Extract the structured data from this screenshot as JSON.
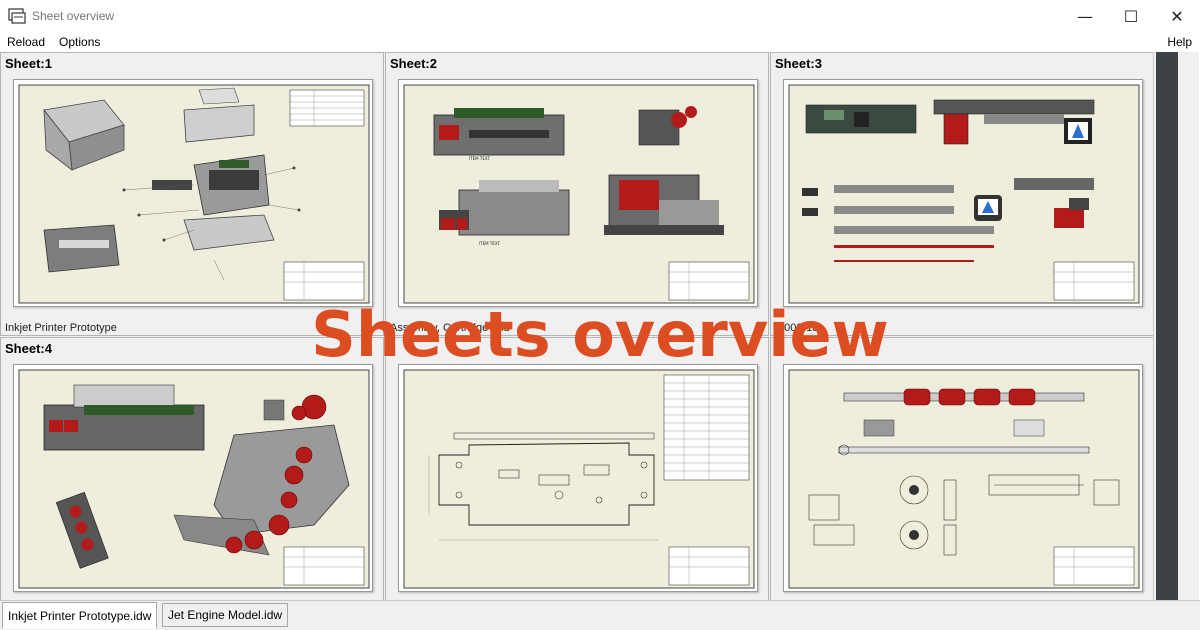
{
  "window": {
    "title": "Sheet overview",
    "minimize": "—",
    "maximize": "☐",
    "close": "✕"
  },
  "menu": {
    "items": [
      "Reload",
      "Options"
    ],
    "help": "Help"
  },
  "sheets": [
    {
      "title": "Sheet:1",
      "caption": "Inkjet Printer Prototype"
    },
    {
      "title": "Sheet:2",
      "caption": "Assembly, Cartridge and"
    },
    {
      "title": "Sheet:3",
      "caption": "...000-13"
    },
    {
      "title": "Sheet:4",
      "caption": ""
    },
    {
      "title": "",
      "caption": ""
    },
    {
      "title": "",
      "caption": ""
    }
  ],
  "tabs": [
    {
      "label": "Inkjet Printer Prototype.idw",
      "active": true
    },
    {
      "label": "Jet Engine Model.idw",
      "active": false
    }
  ],
  "overlay": {
    "text": "Sheets overview",
    "color": "#dd4d22"
  },
  "colors": {
    "sheet_paper": "#efeedd",
    "scrollbar": "#3c4246",
    "part_red": "#b31a1a",
    "part_green": "#2f5a2a"
  }
}
